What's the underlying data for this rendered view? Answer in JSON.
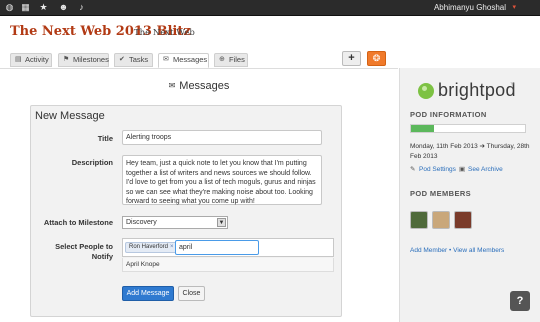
{
  "topbar": {
    "icons": [
      "globe-icon",
      "grid-icon",
      "star-icon",
      "user-icon",
      "bell-icon"
    ],
    "user_name": "Abhimanyu Ghoshal",
    "caret": "▾"
  },
  "header": {
    "title": "The Next Web 2013 Blitz",
    "subtitle": "The Next Web"
  },
  "tabs": [
    {
      "label": "Activity",
      "icon": "list-icon",
      "glyph": "▤"
    },
    {
      "label": "Milestones",
      "icon": "flag-icon",
      "glyph": "⚑"
    },
    {
      "label": "Tasks",
      "icon": "check-icon",
      "glyph": "✔"
    },
    {
      "label": "Messages",
      "icon": "envelope-icon",
      "glyph": "✉"
    },
    {
      "label": "Files",
      "icon": "paperclip-icon",
      "glyph": "⊕"
    }
  ],
  "toolbar": {
    "add_glyph": "+",
    "brightpod_glyph": "❂"
  },
  "main": {
    "heading": "Messages",
    "heading_glyph": "✉"
  },
  "form": {
    "heading": "New Message",
    "title_label": "Title",
    "title_value": "Alerting troops",
    "description_label": "Description",
    "description_value": "Hey team, just a quick note to let you know that I'm putting together a list of writers and news sources we should follow. I'd love to get from you a list of tech moguls, gurus and ninjas so we can see what they're making noise about too. Looking forward to seeing what you come up with!",
    "milestone_label": "Attach to Milestone",
    "milestone_value": "Discovery",
    "people_label_1": "Select People to",
    "people_label_2": "Notify",
    "chip_name": "Ron Haverford",
    "chip_x": "×",
    "people_input_value": "april",
    "suggestion": "April Knope",
    "add_label": "Add Message",
    "close_label": "Close"
  },
  "sidebar": {
    "logo": "brightpod",
    "tm": "™",
    "pod_info_heading": "POD INFORMATION",
    "progress_fraction": 0.2,
    "date_range": "Monday, 11th Feb 2013 ➔ Thursday, 28th Feb 2013",
    "pod_settings": "Pod Settings",
    "see_archive": "See Archive",
    "pod_members_heading": "POD MEMBERS",
    "members_links": "Add Member • View all Members"
  },
  "help": "?",
  "colors": {
    "accent_orange": "#f07a2b",
    "title_red": "#b23a14",
    "link_blue": "#2a6ebb",
    "button_blue": "#2f7ad0",
    "progress_green": "#5cb85c",
    "logo_green": "#7dc243"
  }
}
